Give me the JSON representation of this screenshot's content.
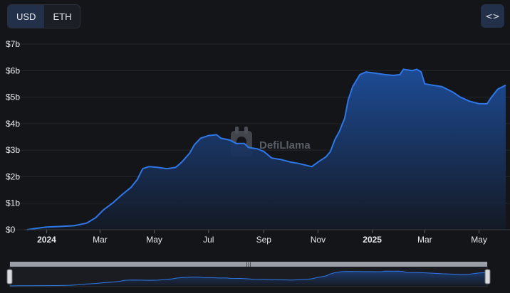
{
  "currency_toggle": {
    "options": [
      "USD",
      "ETH"
    ],
    "active": "USD"
  },
  "embed_button": {
    "icon": "code-icon",
    "label": "<>"
  },
  "watermark": {
    "text": "DefiLlama"
  },
  "colors": {
    "line": "#2f77e8",
    "fill_top": "#1d4e9c",
    "fill_bottom": "#141a26",
    "grid": "#25272d",
    "background": "#141518"
  },
  "chart_data": {
    "type": "area",
    "title": "",
    "xlabel": "",
    "ylabel": "",
    "ylim": [
      0,
      7
    ],
    "y_unit": "billion USD",
    "y_ticks": [
      "$0",
      "$1b",
      "$2b",
      "$3b",
      "$4b",
      "$5b",
      "$6b",
      "$7b"
    ],
    "x_ticks": [
      {
        "label": "2024",
        "date": "2024-01-01",
        "bold": true
      },
      {
        "label": "Mar",
        "date": "2024-03-01",
        "bold": false
      },
      {
        "label": "May",
        "date": "2024-05-01",
        "bold": false
      },
      {
        "label": "Jul",
        "date": "2024-07-01",
        "bold": false
      },
      {
        "label": "Sep",
        "date": "2024-09-01",
        "bold": false
      },
      {
        "label": "Nov",
        "date": "2024-11-01",
        "bold": false
      },
      {
        "label": "2025",
        "date": "2025-01-01",
        "bold": true
      },
      {
        "label": "Mar",
        "date": "2025-03-01",
        "bold": false
      },
      {
        "label": "May",
        "date": "2025-05-01",
        "bold": false
      }
    ],
    "xlim": [
      "2023-12-10",
      "2025-05-31"
    ],
    "grid": true,
    "series": [
      {
        "values": [
          [
            "2023-12-10",
            0.0
          ],
          [
            "2023-12-20",
            0.05
          ],
          [
            "2024-01-01",
            0.1
          ],
          [
            "2024-01-15",
            0.12
          ],
          [
            "2024-02-01",
            0.15
          ],
          [
            "2024-02-15",
            0.25
          ],
          [
            "2024-02-25",
            0.45
          ],
          [
            "2024-03-05",
            0.75
          ],
          [
            "2024-03-15",
            1.0
          ],
          [
            "2024-03-25",
            1.3
          ],
          [
            "2024-04-05",
            1.6
          ],
          [
            "2024-04-12",
            1.9
          ],
          [
            "2024-04-15",
            2.1
          ],
          [
            "2024-04-18",
            2.3
          ],
          [
            "2024-04-25",
            2.38
          ],
          [
            "2024-05-05",
            2.35
          ],
          [
            "2024-05-15",
            2.3
          ],
          [
            "2024-05-25",
            2.35
          ],
          [
            "2024-06-01",
            2.55
          ],
          [
            "2024-06-10",
            2.9
          ],
          [
            "2024-06-15",
            3.2
          ],
          [
            "2024-06-22",
            3.45
          ],
          [
            "2024-07-01",
            3.55
          ],
          [
            "2024-07-10",
            3.58
          ],
          [
            "2024-07-15",
            3.45
          ],
          [
            "2024-07-25",
            3.38
          ],
          [
            "2024-08-01",
            3.25
          ],
          [
            "2024-08-10",
            3.25
          ],
          [
            "2024-08-15",
            3.1
          ],
          [
            "2024-08-25",
            3.05
          ],
          [
            "2024-09-01",
            2.95
          ],
          [
            "2024-09-10",
            2.7
          ],
          [
            "2024-09-20",
            2.65
          ],
          [
            "2024-10-01",
            2.55
          ],
          [
            "2024-10-10",
            2.5
          ],
          [
            "2024-10-20",
            2.42
          ],
          [
            "2024-10-25",
            2.38
          ],
          [
            "2024-11-01",
            2.55
          ],
          [
            "2024-11-10",
            2.75
          ],
          [
            "2024-11-15",
            2.95
          ],
          [
            "2024-11-20",
            3.4
          ],
          [
            "2024-11-25",
            3.7
          ],
          [
            "2024-12-01",
            4.2
          ],
          [
            "2024-12-05",
            4.9
          ],
          [
            "2024-12-10",
            5.4
          ],
          [
            "2024-12-18",
            5.85
          ],
          [
            "2024-12-25",
            5.95
          ],
          [
            "2025-01-05",
            5.9
          ],
          [
            "2025-01-15",
            5.85
          ],
          [
            "2025-01-25",
            5.82
          ],
          [
            "2025-02-01",
            5.85
          ],
          [
            "2025-02-05",
            6.05
          ],
          [
            "2025-02-15",
            6.0
          ],
          [
            "2025-02-20",
            6.05
          ],
          [
            "2025-02-25",
            5.95
          ],
          [
            "2025-03-01",
            5.5
          ],
          [
            "2025-03-10",
            5.45
          ],
          [
            "2025-03-20",
            5.4
          ],
          [
            "2025-04-01",
            5.2
          ],
          [
            "2025-04-10",
            5.0
          ],
          [
            "2025-04-20",
            4.85
          ],
          [
            "2025-05-01",
            4.75
          ],
          [
            "2025-05-10",
            4.75
          ],
          [
            "2025-05-15",
            5.0
          ],
          [
            "2025-05-22",
            5.3
          ],
          [
            "2025-05-31",
            5.45
          ]
        ]
      }
    ]
  }
}
